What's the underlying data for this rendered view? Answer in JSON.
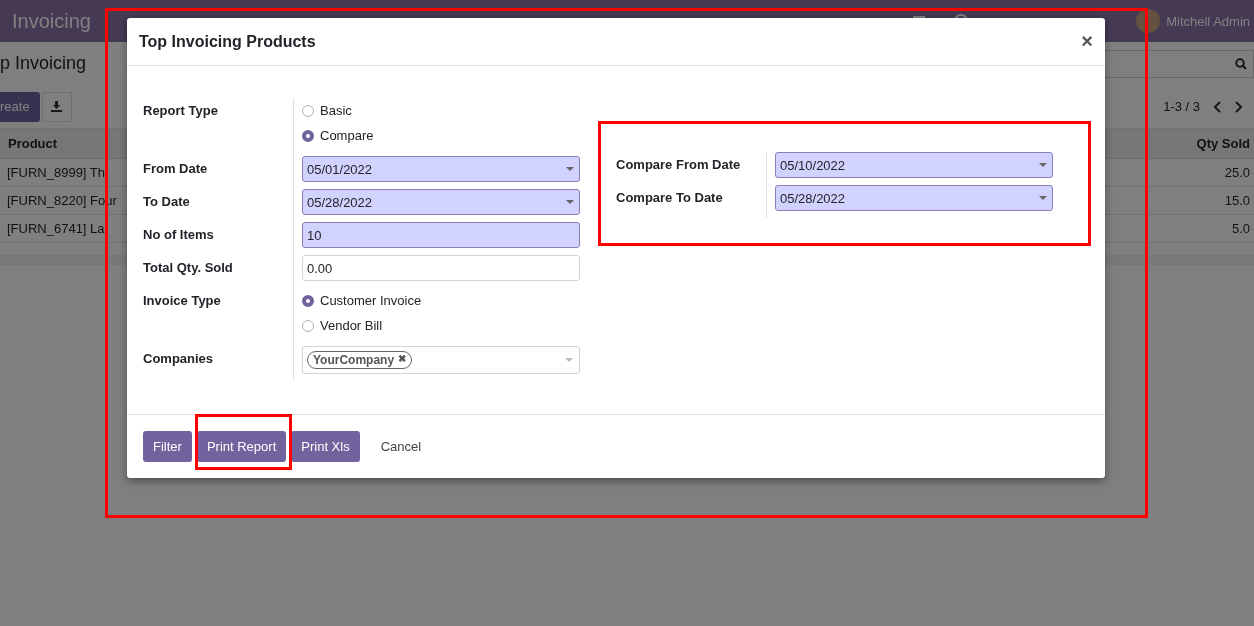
{
  "navbar": {
    "app_name": "Invoicing",
    "badges": [
      {
        "kind": "chat"
      },
      {
        "kind": "activity"
      }
    ],
    "user": "Mitchell Admin"
  },
  "control_panel": {
    "breadcrumb": "p Invoicing",
    "create_button": "reate",
    "pager": "1-3 / 3"
  },
  "table": {
    "columns": [
      "Product",
      "Qty Sold"
    ],
    "rows": [
      [
        "[FURN_8999] Th",
        "25.0"
      ],
      [
        "[FURN_8220] Four",
        "15.0"
      ],
      [
        "[FURN_6741] La",
        "5.0"
      ]
    ]
  },
  "dialog": {
    "title": "Top Invoicing Products",
    "close": "×",
    "left_fields": [
      {
        "label": "Report Type",
        "kind": "radio",
        "options": [
          {
            "label": "Basic",
            "selected": false
          },
          {
            "label": "Compare",
            "selected": true
          }
        ]
      },
      {
        "label": "From Date",
        "kind": "date",
        "value": "05/01/2022",
        "required": true
      },
      {
        "label": "To Date",
        "kind": "date",
        "value": "05/28/2022",
        "required": true
      },
      {
        "label": "No of Items",
        "kind": "text",
        "value": "10",
        "required": true
      },
      {
        "label": "Total Qty. Sold",
        "kind": "text",
        "value": "0.00",
        "required": false
      },
      {
        "label": "Invoice Type",
        "kind": "radio",
        "options": [
          {
            "label": "Customer Invoice",
            "selected": true
          },
          {
            "label": "Vendor Bill",
            "selected": false
          }
        ]
      },
      {
        "label": "Companies",
        "kind": "tags",
        "tags": [
          "YourCompany"
        ],
        "remove": "✖"
      }
    ],
    "right_fields": [
      {
        "label": "Compare From Date",
        "kind": "date",
        "value": "05/10/2022",
        "required": true
      },
      {
        "label": "Compare To Date",
        "kind": "date",
        "value": "05/28/2022",
        "required": true
      }
    ],
    "buttons": [
      {
        "label": "Filter",
        "kind": "primary"
      },
      {
        "label": "Print Report",
        "kind": "primary"
      },
      {
        "label": "Print Xls",
        "kind": "primary"
      },
      {
        "label": "Cancel",
        "kind": "link"
      }
    ]
  }
}
